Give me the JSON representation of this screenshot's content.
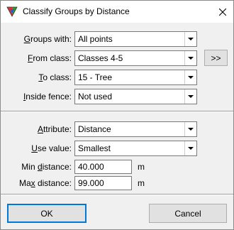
{
  "window": {
    "title": "Classify Groups by Distance"
  },
  "icons": {
    "app": "classify-triangle-icon",
    "close": "close-icon",
    "dropdown": "chevron-down-icon"
  },
  "form": {
    "groups_with": {
      "label_u": "G",
      "label_rest": "roups with:",
      "value": "All points"
    },
    "from_class": {
      "label_u": "F",
      "label_rest": "rom class:",
      "value": "Classes 4-5"
    },
    "to_class": {
      "label_u": "T",
      "label_rest": "o class:",
      "value": "15 - Tree"
    },
    "inside_fence": {
      "label_u": "I",
      "label_rest": "nside fence:",
      "value": "Not used"
    },
    "attribute": {
      "label_pre": "",
      "label_u": "A",
      "label_rest": "ttribute:",
      "value": "Distance"
    },
    "use_value": {
      "label_u": "U",
      "label_rest": "se value:",
      "value": "Smallest"
    },
    "min_distance": {
      "label_pre": "Min ",
      "label_u": "d",
      "label_rest": "istance:",
      "value": "40.000",
      "unit": "m"
    },
    "max_distance": {
      "label_pre": "Ma",
      "label_u": "x",
      "label_rest": " distance:",
      "value": "99.000",
      "unit": "m"
    }
  },
  "buttons": {
    "more": ">>",
    "ok": "OK",
    "cancel": "Cancel"
  }
}
